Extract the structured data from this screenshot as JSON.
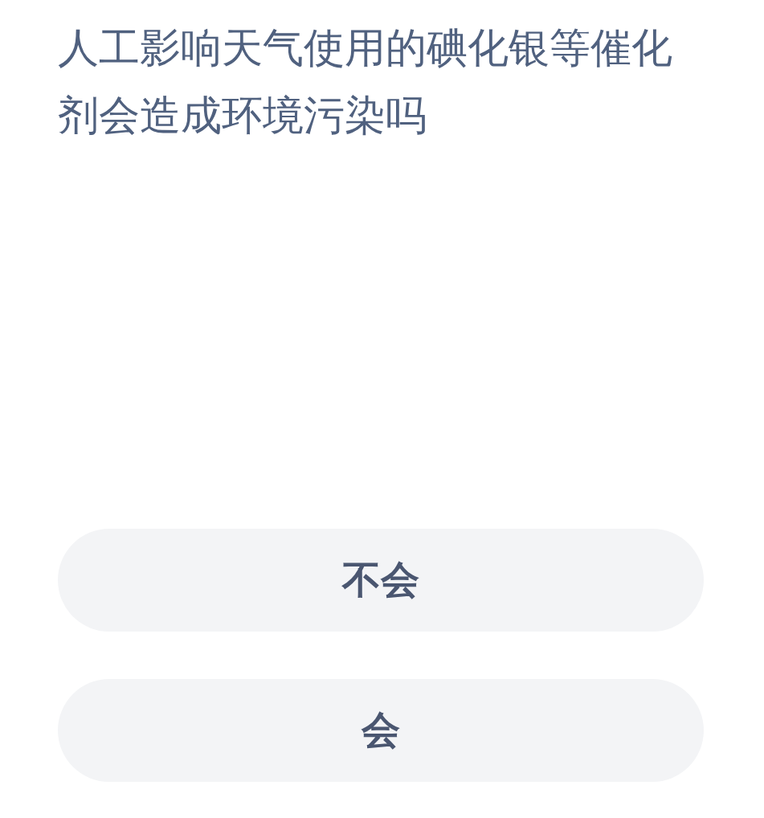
{
  "question": "人工影响天气使用的碘化银等催化剂会造成环境污染吗",
  "options": [
    {
      "label": "不会"
    },
    {
      "label": "会"
    }
  ]
}
